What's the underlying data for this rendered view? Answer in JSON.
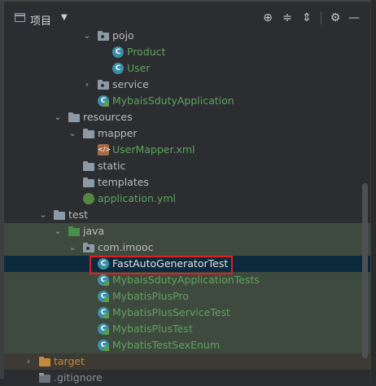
{
  "header": {
    "title": "项目",
    "dropdown_glyph": "▼",
    "toolbar": [
      {
        "name": "locate-icon",
        "glyph": "⊕"
      },
      {
        "name": "collapse-all-icon",
        "glyph": "≑"
      },
      {
        "name": "expand-all-icon",
        "glyph": "⇕"
      },
      {
        "name": "gear-icon",
        "glyph": "⚙"
      },
      {
        "name": "hide-icon",
        "glyph": "—"
      }
    ]
  },
  "tree": {
    "pojo": "pojo",
    "product": "Product",
    "user": "User",
    "service": "service",
    "mybais_app": "MybaisSdutyApplication",
    "resources": "resources",
    "mapper": "mapper",
    "user_mapper_xml": "UserMapper.xml",
    "static": "static",
    "templates": "templates",
    "application_yml": "application.yml",
    "test": "test",
    "java": "java",
    "com_imooc": "com.imooc",
    "fast_auto": "FastAutoGeneratorTest",
    "mybais_app_tests": "MybaisSdutyApplicationTests",
    "plus_pro": "MybatisPlusPro",
    "plus_service_test": "MybatisPlusServiceTest",
    "plus_test": "MybatisPlusTest",
    "sex_enum": "MybatisTestSexEnum",
    "target": "target",
    "gitignore": ".gitignore"
  },
  "icons": {
    "class_letter": "C",
    "xml_label": "</>",
    "expanded": "⌄",
    "collapsed": "›"
  },
  "colors": {
    "selection": "#0d293e",
    "test_highlight": "#3e4a3d",
    "highlight_box": "#e02020",
    "class_icon": "#3a8fa7"
  }
}
